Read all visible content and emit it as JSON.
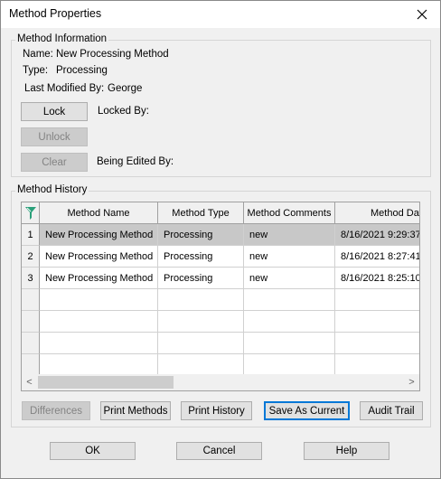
{
  "window": {
    "title": "Method Properties",
    "close_glyph": "✕"
  },
  "info": {
    "group_label": "Method Information",
    "name_label": "Name:",
    "name_value": "New Processing Method",
    "type_label": "Type:",
    "type_value": "Processing",
    "modified_label": "Last Modified By:",
    "modified_value": "George",
    "lock_button": "Lock",
    "locked_by_label": "Locked By:",
    "unlock_button": "Unlock",
    "clear_button": "Clear",
    "being_edited_label": "Being Edited By:"
  },
  "history": {
    "group_label": "Method History",
    "columns": [
      "Method Name",
      "Method Type",
      "Method Comments",
      "Method Dat"
    ],
    "rows": [
      {
        "num": "1",
        "name": "New Processing Method",
        "type": "Processing",
        "comments": "new",
        "date": "8/16/2021 9:29:37"
      },
      {
        "num": "2",
        "name": "New Processing Method",
        "type": "Processing",
        "comments": "new",
        "date": "8/16/2021 8:27:41"
      },
      {
        "num": "3",
        "name": "New Processing Method",
        "type": "Processing",
        "comments": "new",
        "date": "8/16/2021 8:25:10"
      }
    ],
    "scroll_left": "<",
    "scroll_right": ">",
    "buttons": {
      "differences": "Differences",
      "print_methods": "Print Methods",
      "print_history": "Print History",
      "save_as_current": "Save As Current",
      "audit_trail": "Audit Trail"
    }
  },
  "footer": {
    "ok": "OK",
    "cancel": "Cancel",
    "help": "Help"
  },
  "colors": {
    "accent": "#0078d7",
    "selected_row": "#c8c8c8",
    "icon_green": "#2aa07a"
  }
}
